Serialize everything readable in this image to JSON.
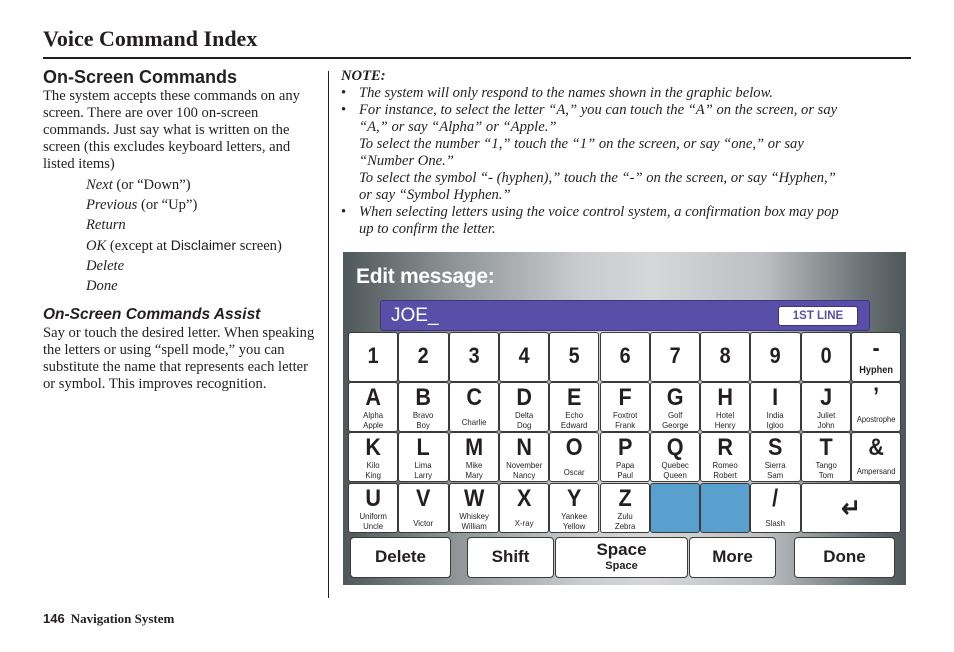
{
  "page": {
    "title": "Voice Command Index",
    "footer_page_number": "146",
    "footer_title": "Navigation System"
  },
  "left": {
    "heading": "On-Screen Commands",
    "intro": "The system accepts these commands on any screen. There are over 100 on-screen commands. Just say what is written on the screen (this excludes keyboard letters, and listed items)",
    "commands": [
      {
        "cmd": "Next",
        "note": " (or “Down”)"
      },
      {
        "cmd": "Previous",
        "note": " (or “Up”)"
      },
      {
        "cmd": "Return",
        "note": ""
      },
      {
        "cmd": "OK",
        "note_pre": " (except at ",
        "note_sans": "Disclaimer",
        "note_post": " screen)"
      },
      {
        "cmd": "Delete",
        "note": ""
      },
      {
        "cmd": "Done",
        "note": ""
      }
    ],
    "assist_heading": "On-Screen Commands Assist",
    "assist_text": "Say or touch the desired letter. When speaking the letters or using “spell mode,” you can substitute the name that represents each letter or symbol. This improves recognition."
  },
  "note": {
    "label": "NOTE:",
    "bullet1": "The system will only respond to the names shown in the graphic below.",
    "bullet2_l1": "For instance, to select the letter “A,” you can touch the “A” on the screen, or say",
    "bullet2_l2": "“A,” or say “Alpha” or “Apple.”",
    "bullet2_l3": "To select the number “1,” touch the “1” on the screen, or say “one,” or say",
    "bullet2_l4": "“Number One.”",
    "bullet2_l5": "To select the symbol “- (hyphen),” touch the “-” on the screen, or say “Hyphen,”",
    "bullet2_l6": "or say “Symbol Hyphen.”",
    "bullet3_l1": "When selecting letters using the voice control system, a confirmation box may pop",
    "bullet3_l2": "up to confirm the letter.",
    "bullet_glyph": "•"
  },
  "screen": {
    "title": "Edit message:",
    "input_value": "JOE_",
    "line_badge": "1ST LINE",
    "colors": {
      "input_bar": "#5a4fa8",
      "blank_key": "#5aa0cf"
    },
    "rows": [
      [
        {
          "main": "1"
        },
        {
          "main": "2"
        },
        {
          "main": "3"
        },
        {
          "main": "4"
        },
        {
          "main": "5"
        },
        {
          "main": "6"
        },
        {
          "main": "7"
        },
        {
          "main": "8"
        },
        {
          "main": "9"
        },
        {
          "main": "0"
        },
        {
          "main": "-",
          "sub": "Hyphen"
        }
      ],
      [
        {
          "main": "A",
          "sub": "Alpha",
          "sub2": "Apple"
        },
        {
          "main": "B",
          "sub": "Bravo",
          "sub2": "Boy"
        },
        {
          "main": "C",
          "sub": "Charlie"
        },
        {
          "main": "D",
          "sub": "Delta",
          "sub2": "Dog"
        },
        {
          "main": "E",
          "sub": "Echo",
          "sub2": "Edward"
        },
        {
          "main": "F",
          "sub": "Foxtrot",
          "sub2": "Frank"
        },
        {
          "main": "G",
          "sub": "Golf",
          "sub2": "George"
        },
        {
          "main": "H",
          "sub": "Hotel",
          "sub2": "Henry"
        },
        {
          "main": "I",
          "sub": "India",
          "sub2": "Igloo"
        },
        {
          "main": "J",
          "sub": "Juliet",
          "sub2": "John"
        },
        {
          "main": "’",
          "sub": "Apostrophe"
        }
      ],
      [
        {
          "main": "K",
          "sub": "Kilo",
          "sub2": "King"
        },
        {
          "main": "L",
          "sub": "Lima",
          "sub2": "Larry"
        },
        {
          "main": "M",
          "sub": "Mike",
          "sub2": "Mary"
        },
        {
          "main": "N",
          "sub": "November",
          "sub2": "Nancy"
        },
        {
          "main": "O",
          "sub": "Oscar"
        },
        {
          "main": "P",
          "sub": "Papa",
          "sub2": "Paul"
        },
        {
          "main": "Q",
          "sub": "Quebec",
          "sub2": "Queen"
        },
        {
          "main": "R",
          "sub": "Romeo",
          "sub2": "Robert"
        },
        {
          "main": "S",
          "sub": "Sierra",
          "sub2": "Sam"
        },
        {
          "main": "T",
          "sub": "Tango",
          "sub2": "Tom"
        },
        {
          "main": "&",
          "sub": "Ampersand"
        }
      ],
      [
        {
          "main": "U",
          "sub": "Uniform",
          "sub2": "Uncle"
        },
        {
          "main": "V",
          "sub": "Victor"
        },
        {
          "main": "W",
          "sub": "Whiskey",
          "sub2": "William"
        },
        {
          "main": "X",
          "sub": "X-ray"
        },
        {
          "main": "Y",
          "sub": "Yankee",
          "sub2": "Yellow"
        },
        {
          "main": "Z",
          "sub": "Zulu",
          "sub2": "Zebra"
        },
        {
          "blank": true
        },
        {
          "blank": true
        },
        {
          "main": "/",
          "sub": "Slash"
        },
        {
          "main": "↵",
          "enter": true,
          "icon": "enter-icon"
        }
      ]
    ],
    "function_buttons": [
      {
        "label": "Delete"
      },
      {
        "label": "Shift"
      },
      {
        "label": "Space",
        "sub": "Space"
      },
      {
        "label": "More"
      },
      {
        "label": "Done"
      }
    ]
  }
}
